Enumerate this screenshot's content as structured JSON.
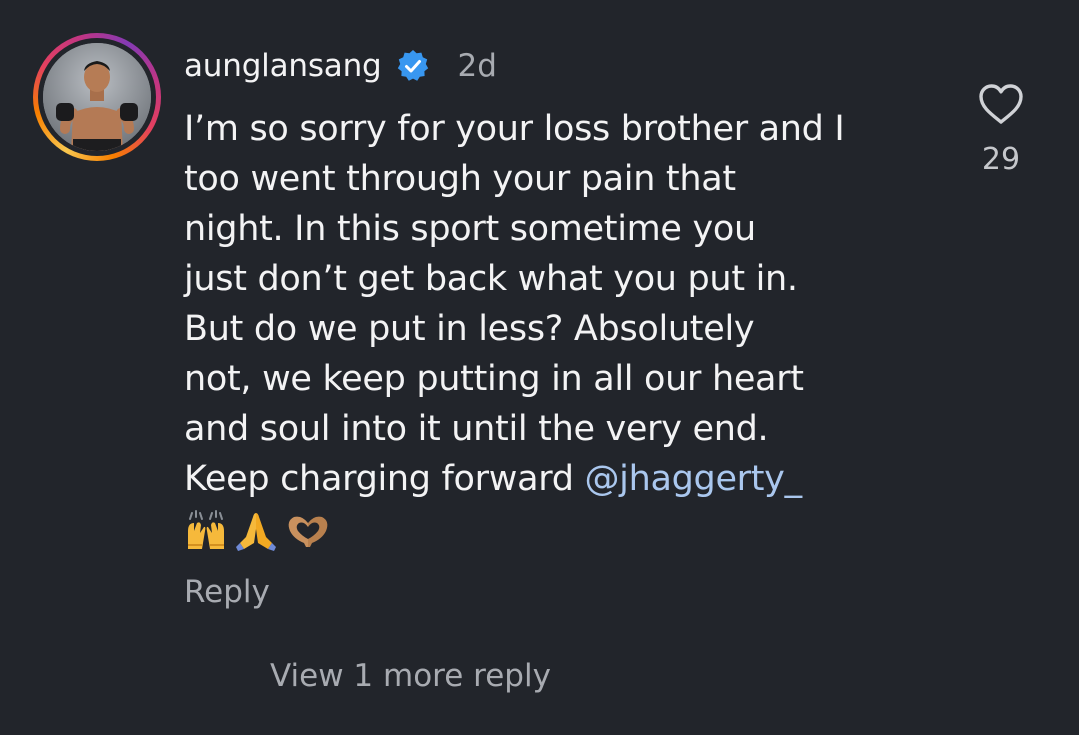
{
  "comment": {
    "username": "aunglansang",
    "time": "2d",
    "body_lines": [
      "I’m so sorry for your loss brother and I",
      "too went through your pain that",
      "night.  In this sport sometime you",
      "just don’t get back what you put in.",
      "But do we put in less?  Absolutely",
      "not, we keep putting in all our heart",
      "and soul into it until the very end."
    ],
    "last_line_prefix": "Keep charging forward ",
    "mention": "@jhaggerty_",
    "emojis": [
      "raising-hands-emoji",
      "folded-hands-emoji",
      "heart-hands-emoji"
    ],
    "like_count": "29",
    "reply_label": "Reply",
    "view_more_label": "View 1 more reply"
  },
  "icons": {
    "verified": "verified-badge-icon",
    "like": "heart-outline-icon"
  },
  "colors": {
    "background": "#22252b",
    "text": "#f3f3f4",
    "muted": "#a8abb1",
    "mention": "#aac7ee",
    "verified": "#3897f0"
  }
}
